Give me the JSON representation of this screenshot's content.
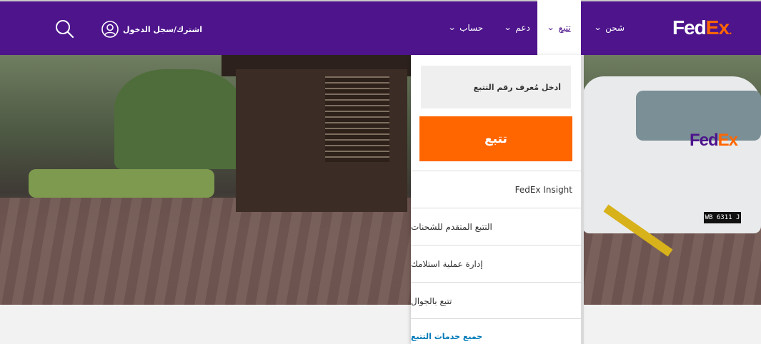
{
  "header": {
    "logo": {
      "fed": "Fed",
      "ex": "Ex",
      "dot": "."
    },
    "nav": [
      {
        "label": "شحن",
        "chevron": "chevron-down-icon"
      },
      {
        "label": "تتبع",
        "chevron": "chevron-down-icon",
        "active": true
      },
      {
        "label": "دعم",
        "chevron": "chevron-down-icon"
      },
      {
        "label": "حساب",
        "chevron": "chevron-down-icon"
      }
    ],
    "signin_label": "اشترك/سجل الدخول",
    "search_icon": "search-icon",
    "user_icon": "user-icon"
  },
  "hero": {
    "van_logo": {
      "fed": "Fed",
      "ex": "Ex"
    },
    "plate": "WB 6311 J"
  },
  "dropdown": {
    "input_placeholder": "أدخل مُعرف رقم التتبع",
    "input_value": "",
    "track_button": "تتبع",
    "links": [
      {
        "label": "FedEx Insight"
      },
      {
        "label": "التتبع المتقدم للشحنات"
      },
      {
        "label": "إدارة عملية استلامك"
      },
      {
        "label": "تتبع بالجوال"
      }
    ],
    "all_services": "جميع خدمات التتبع"
  },
  "colors": {
    "brand_purple": "#4d148c",
    "brand_orange": "#ff6600",
    "link_blue": "#007ab7"
  }
}
